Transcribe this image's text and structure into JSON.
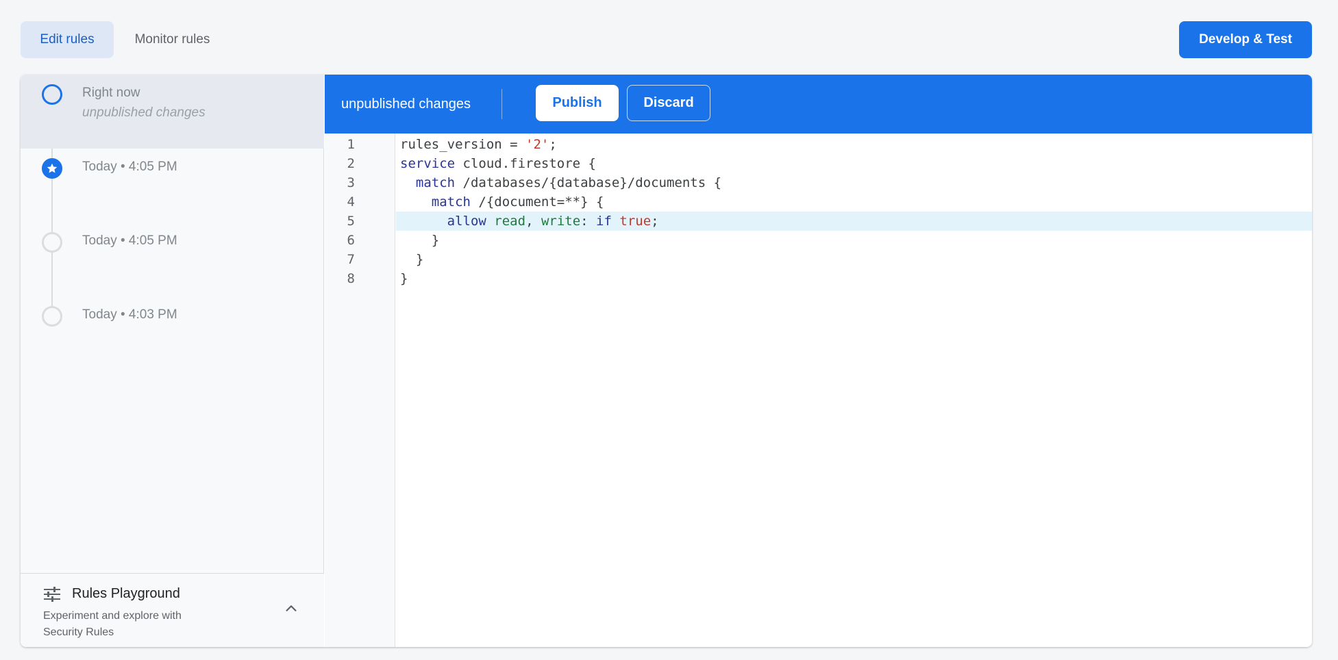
{
  "tabs": {
    "edit_rules": "Edit rules",
    "monitor_rules": "Monitor rules"
  },
  "actions": {
    "develop_test": "Develop & Test"
  },
  "history": {
    "items": [
      {
        "label": "Right now",
        "sublabel": "unpublished changes",
        "active": true,
        "icon": "circle-outline-icon"
      },
      {
        "label": "Today • 4:05 PM",
        "active": false,
        "icon": "star-icon"
      },
      {
        "label": "Today • 4:05 PM",
        "active": false,
        "icon": "circle-outline-icon"
      },
      {
        "label": "Today • 4:03 PM",
        "active": false,
        "icon": "circle-outline-icon"
      }
    ]
  },
  "playground": {
    "title": "Rules Playground",
    "description": "Experiment and explore with Security Rules",
    "icon": "tune-icon",
    "toggle_icon": "chevron-up-icon"
  },
  "editor": {
    "status": "unpublished changes",
    "publish_label": "Publish",
    "discard_label": "Discard",
    "line_numbers": [
      "1",
      "2",
      "3",
      "4",
      "5",
      "6",
      "7",
      "8"
    ],
    "highlighted_line": 5,
    "code": {
      "l1_name": "rules_version",
      "l1_eq": " = ",
      "l1_str": "'2'",
      "l1_end": ";",
      "l2_kw": "service",
      "l2_rest": " cloud.firestore {",
      "l3_indent": "  ",
      "l3_kw": "match",
      "l3_rest": " /databases/{database}/documents {",
      "l4_indent": "    ",
      "l4_kw": "match",
      "l4_rest": " /{document=**} {",
      "l5_indent": "      ",
      "l5_allow": "allow",
      "l5_sp": " ",
      "l5_read": "read",
      "l5_comma": ", ",
      "l5_write": "write",
      "l5_colon": ": ",
      "l5_if": "if",
      "l5_sp2": " ",
      "l5_true": "true",
      "l5_end": ";",
      "l6": "    }",
      "l7": "  }",
      "l8": "}"
    }
  },
  "colors": {
    "primary": "#1a73e8",
    "active_tab_bg": "#dde7f6",
    "keyword": "#283593",
    "string": "#c0392b",
    "permission": "#1e7a3e",
    "highlight_line": "#e3f3fb"
  }
}
